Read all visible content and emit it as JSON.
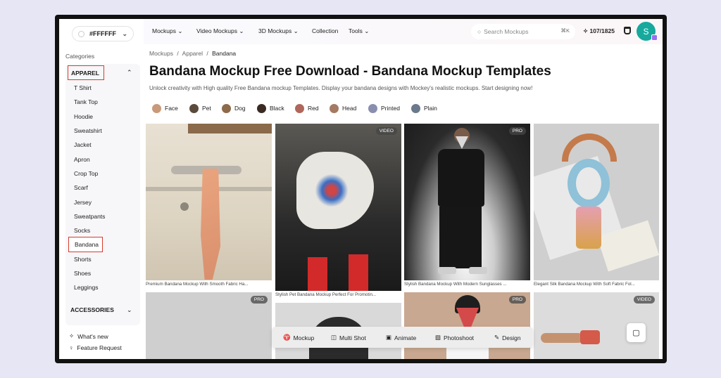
{
  "sidebar": {
    "color_value": "#FFFFFF",
    "categories_heading": "Categories",
    "group_label": "APPAREL",
    "items": [
      "T Shirt",
      "Tank Top",
      "Hoodie",
      "Sweatshirt",
      "Jacket",
      "Apron",
      "Crop Top",
      "Scarf",
      "Jersey",
      "Sweatpants",
      "Socks",
      "Bandana",
      "Shorts",
      "Shoes",
      "Leggings"
    ],
    "active_item": "Bandana",
    "accessories_label": "ACCESSORIES",
    "whats_new": "What's new",
    "feature_request": "Feature Request"
  },
  "topnav": {
    "items": [
      "Mockups",
      "Video Mockups",
      "3D Mockups",
      "Collection",
      "Tools"
    ],
    "search_placeholder": "Search Mockups",
    "search_shortcut": "⌘K",
    "credits": "107/1825",
    "avatar_letter": "S"
  },
  "breadcrumb": [
    "Mockups",
    "/",
    "Apparel",
    "/",
    "Bandana"
  ],
  "title": "Bandana Mockup Free Download - Bandana Mockup Templates",
  "subtitle": "Unlock creativity with High quality Free Bandana mockup Templates. Display your bandana designs with Mockey's realistic mockups. Start designing now!",
  "filters": [
    "Face",
    "Pet",
    "Dog",
    "Black",
    "Red",
    "Head",
    "Printed",
    "Plain"
  ],
  "cards": [
    {
      "badge": "",
      "caption": "Premium Bandana Mockup With Smooth Fabric Ha..."
    },
    {
      "badge": "VIDEO",
      "caption": "Stylish Pet Bandana Mockup Perfect For Promotin..."
    },
    {
      "badge": "PRO",
      "caption": "Stylish Bandana Mockup With Modern Sunglasses ..."
    },
    {
      "badge": "",
      "caption": "Elegant Silk Bandana Mockup With Soft Fabric Fol..."
    },
    {
      "badge": "PRO",
      "caption": ""
    },
    {
      "badge": "",
      "caption": ""
    },
    {
      "badge": "PRO",
      "caption": ""
    },
    {
      "badge": "VIDEO",
      "caption": ""
    }
  ],
  "toolbar": [
    "Mockup",
    "Multi Shot",
    "Animate",
    "Photoshoot",
    "Design"
  ],
  "colors": {
    "highlight": "#d93a2b",
    "avatar": "#17a99d",
    "badge": "#9b6df1"
  }
}
